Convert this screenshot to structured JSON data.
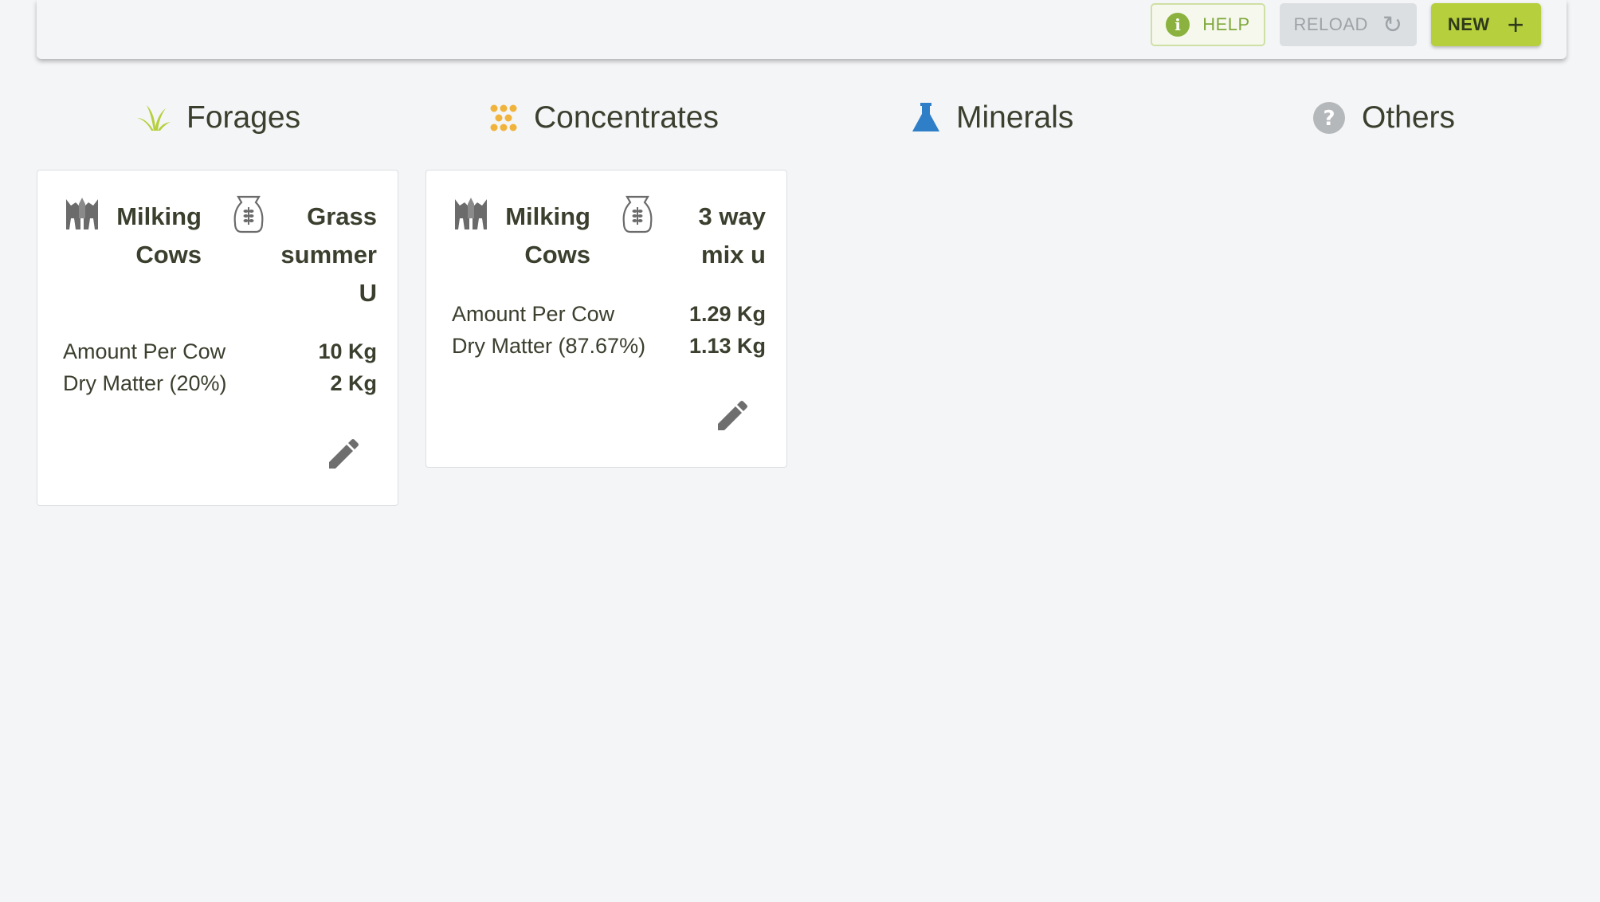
{
  "toolbar": {
    "help_label": "HELP",
    "reload_label": "RELOAD",
    "new_label": "NEW",
    "accent_color": "#b6cf3c"
  },
  "categories": [
    {
      "label": "Forages",
      "icon": "grass-icon",
      "color": "#b6cf3c"
    },
    {
      "label": "Concentrates",
      "icon": "dots-icon",
      "color": "#f0b43c"
    },
    {
      "label": "Minerals",
      "icon": "flask-icon",
      "color": "#2f7fc8"
    },
    {
      "label": "Others",
      "icon": "question-icon",
      "color": "#b5b8bb"
    }
  ],
  "cards": [
    {
      "animal": "Milking Cows",
      "feed": "Grass summer U",
      "rows": [
        {
          "label": "Amount Per Cow",
          "value": "10 Kg"
        },
        {
          "label": "Dry Matter (20%)",
          "value": "2 Kg"
        }
      ]
    },
    {
      "animal": "Milking Cows",
      "feed": "3 way mix u",
      "rows": [
        {
          "label": "Amount Per Cow",
          "value": "1.29 Kg"
        },
        {
          "label": "Dry Matter (87.67%)",
          "value": "1.13 Kg"
        }
      ]
    }
  ]
}
